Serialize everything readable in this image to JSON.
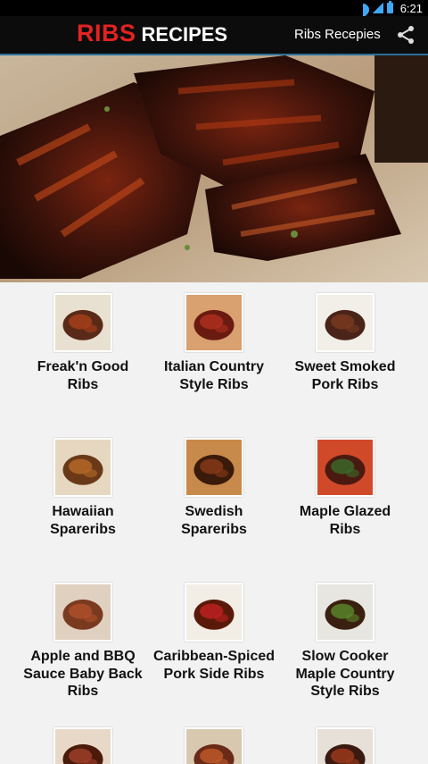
{
  "status_bar": {
    "time": "6:21"
  },
  "action_bar": {
    "title_highlight": "RIBS",
    "title_rest": "RECIPES",
    "menu_label": "Ribs Recepies"
  },
  "recipes": [
    {
      "name": "Freak'n Good Ribs"
    },
    {
      "name": "Italian Country Style Ribs"
    },
    {
      "name": "Sweet Smoked Pork Ribs"
    },
    {
      "name": "Hawaiian Spareribs"
    },
    {
      "name": "Swedish Spareribs"
    },
    {
      "name": "Maple Glazed Ribs"
    },
    {
      "name": "Apple and BBQ Sauce Baby Back Ribs"
    },
    {
      "name": "Caribbean-Spiced Pork Side Ribs"
    },
    {
      "name": "Slow Cooker Maple Country Style Ribs"
    },
    {
      "name": ""
    },
    {
      "name": ""
    },
    {
      "name": ""
    }
  ],
  "colors": {
    "title_red": "#e32222",
    "action_bar": "#0c0c0c",
    "background": "#f2f2f2",
    "status_accent": "#3fa9f5"
  }
}
